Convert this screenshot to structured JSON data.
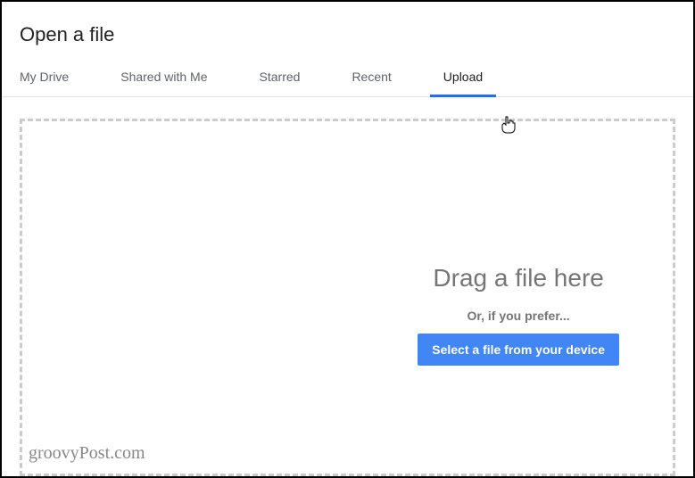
{
  "dialog": {
    "title": "Open a file"
  },
  "tabs": {
    "items": [
      {
        "label": "My Drive",
        "active": false
      },
      {
        "label": "Shared with Me",
        "active": false
      },
      {
        "label": "Starred",
        "active": false
      },
      {
        "label": "Recent",
        "active": false
      },
      {
        "label": "Upload",
        "active": true
      }
    ]
  },
  "upload": {
    "heading": "Drag a file here",
    "subtext": "Or, if you prefer...",
    "button_label": "Select a file from your device"
  },
  "watermark": "groovyPost.com",
  "colors": {
    "accent": "#1a73e8",
    "button": "#4285f4",
    "text_muted": "#757575",
    "border_dashed": "#ccc"
  }
}
